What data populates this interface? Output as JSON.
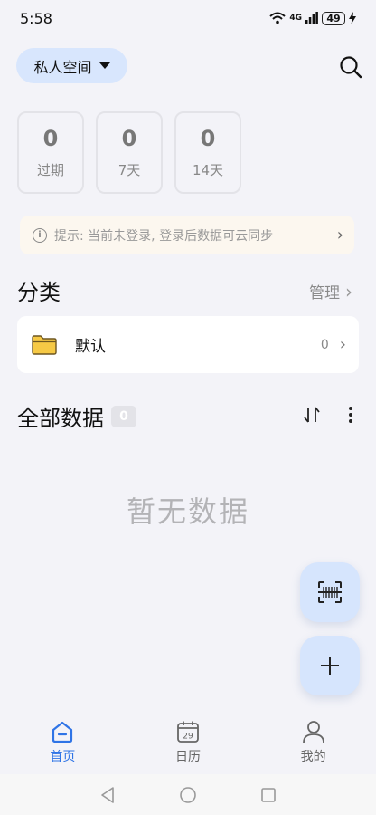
{
  "status": {
    "time": "5:58",
    "network": "4G",
    "battery": "49"
  },
  "header": {
    "space_label": "私人空间"
  },
  "stats": [
    {
      "value": "0",
      "label": "过期"
    },
    {
      "value": "0",
      "label": "7天"
    },
    {
      "value": "0",
      "label": "14天"
    }
  ],
  "tip": {
    "text": "提示: 当前未登录, 登录后数据可云同步"
  },
  "category_section": {
    "title": "分类",
    "manage_label": "管理",
    "items": [
      {
        "name": "默认",
        "count": "0"
      }
    ]
  },
  "all_data": {
    "title": "全部数据",
    "count": "0",
    "empty_text": "暂无数据"
  },
  "bottom_nav": {
    "items": [
      {
        "label": "首页",
        "icon": "home-icon",
        "active": true
      },
      {
        "label": "日历",
        "icon": "calendar-icon",
        "calendar_day": "29"
      },
      {
        "label": "我的",
        "icon": "person-icon"
      }
    ]
  },
  "colors": {
    "accent": "#2f74e6",
    "fab_bg": "#d6e5fd",
    "folder": "#f6c945"
  }
}
